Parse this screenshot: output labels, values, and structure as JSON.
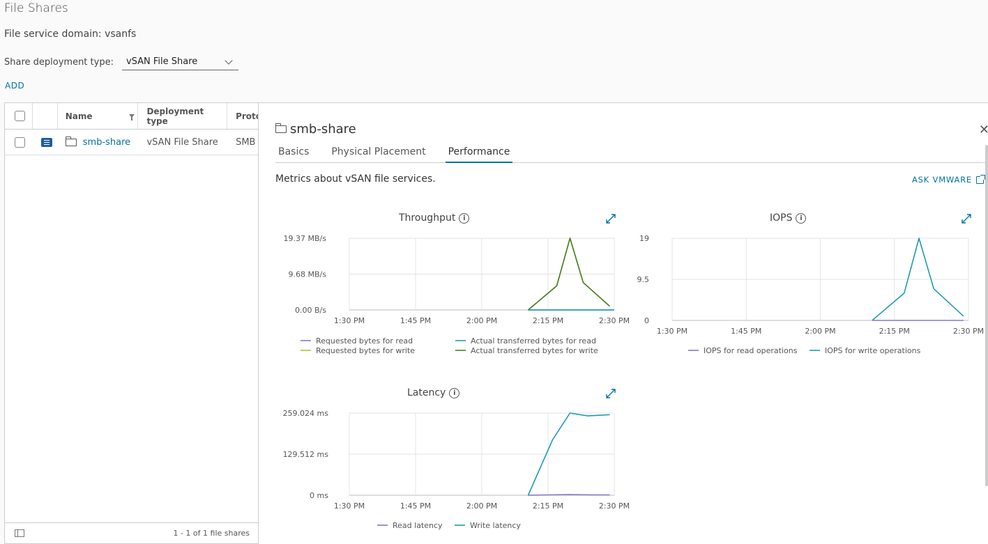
{
  "page": {
    "title": "File Shares",
    "domain_label": "File service domain: vsanfs",
    "deploy_label": "Share deployment type:",
    "deploy_value": "vSAN File Share",
    "add_label": "ADD"
  },
  "grid": {
    "columns": [
      "Name",
      "Deployment type",
      "Proto"
    ],
    "rows": [
      {
        "name": "smb-share",
        "deployment": "vSAN File Share",
        "protocol": "SMB"
      }
    ],
    "footer": "1 - 1 of 1 file shares"
  },
  "detail": {
    "title": "smb-share",
    "tabs": [
      "Basics",
      "Physical Placement",
      "Performance"
    ],
    "active_tab": "Performance",
    "description": "Metrics about vSAN file services.",
    "ask_label": "ASK VMWARE"
  },
  "colors": {
    "accent": "#0072a3",
    "read": "#8477c6",
    "write_blue": "#1b9bb4",
    "write_req": "#a4c639",
    "write_actual": "#4a7d25"
  },
  "chart_data": [
    {
      "type": "line",
      "title": "Throughput",
      "x_ticks": [
        "1:30 PM",
        "1:45 PM",
        "2:00 PM",
        "2:15 PM",
        "2:30 PM"
      ],
      "y_ticks": [
        "19.37 MB/s",
        "9.68 MB/s",
        "0.00 B/s"
      ],
      "ylim": [
        0,
        19.37
      ],
      "y_unit": "MB/s",
      "series": [
        {
          "name": "Requested bytes for read",
          "color": "#8477c6",
          "points": [
            [
              2.175,
              0
            ],
            [
              2.25,
              0
            ],
            [
              2.333,
              0
            ],
            [
              2.417,
              0
            ],
            [
              2.5,
              0
            ]
          ]
        },
        {
          "name": "Actual transferred bytes for read",
          "color": "#1b9bb4",
          "points": [
            [
              2.175,
              0
            ],
            [
              2.25,
              0
            ],
            [
              2.333,
              0
            ],
            [
              2.417,
              0
            ],
            [
              2.5,
              0
            ]
          ]
        },
        {
          "name": "Requested bytes for write",
          "color": "#a4c639",
          "points": [
            [
              2.175,
              0
            ],
            [
              2.283,
              6.5
            ],
            [
              2.333,
              19.37
            ],
            [
              2.383,
              7.4
            ],
            [
              2.483,
              1.0
            ]
          ]
        },
        {
          "name": "Actual transferred bytes for write",
          "color": "#4a7d25",
          "points": [
            [
              2.175,
              0
            ],
            [
              2.283,
              6.5
            ],
            [
              2.333,
              19.37
            ],
            [
              2.383,
              7.4
            ],
            [
              2.483,
              1.0
            ]
          ]
        }
      ]
    },
    {
      "type": "line",
      "title": "IOPS",
      "x_ticks": [
        "1:30 PM",
        "1:45 PM",
        "2:00 PM",
        "2:15 PM",
        "2:30 PM"
      ],
      "y_ticks": [
        "19",
        "9.5",
        "0"
      ],
      "ylim": [
        0,
        19
      ],
      "series": [
        {
          "name": "IOPS for read operations",
          "color": "#8477c6",
          "points": [
            [
              2.175,
              0
            ],
            [
              2.25,
              0
            ],
            [
              2.333,
              0
            ],
            [
              2.417,
              0
            ],
            [
              2.483,
              0
            ]
          ]
        },
        {
          "name": "IOPS for write operations",
          "color": "#1b9bb4",
          "points": [
            [
              2.175,
              0
            ],
            [
              2.283,
              6.3
            ],
            [
              2.333,
              19
            ],
            [
              2.383,
              7.3
            ],
            [
              2.483,
              1.0
            ]
          ]
        }
      ]
    },
    {
      "type": "line",
      "title": "Latency",
      "x_ticks": [
        "1:30 PM",
        "1:45 PM",
        "2:00 PM",
        "2:15 PM",
        "2:30 PM"
      ],
      "y_ticks": [
        "259.024 ms",
        "129.512 ms",
        "0 ms"
      ],
      "ylim": [
        0,
        259.024
      ],
      "series": [
        {
          "name": "Read latency",
          "color": "#8477c6",
          "points": [
            [
              2.175,
              0
            ],
            [
              2.25,
              1
            ],
            [
              2.333,
              2
            ],
            [
              2.417,
              1
            ],
            [
              2.483,
              1
            ]
          ]
        },
        {
          "name": "Write latency",
          "color": "#1b9bb4",
          "points": [
            [
              2.175,
              0
            ],
            [
              2.267,
              175
            ],
            [
              2.333,
              259
            ],
            [
              2.4,
              250
            ],
            [
              2.483,
              254
            ]
          ]
        }
      ]
    }
  ]
}
